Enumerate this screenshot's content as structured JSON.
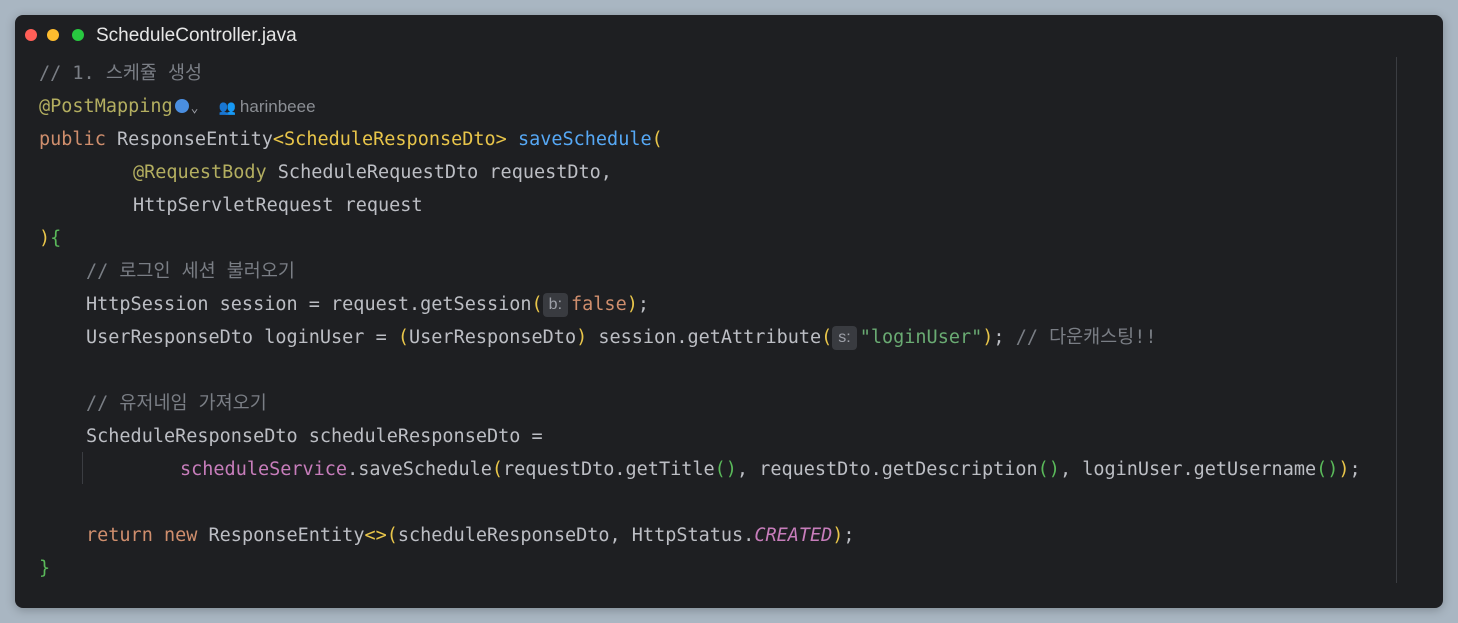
{
  "window": {
    "title": "ScheduleController.java"
  },
  "code": {
    "l1_comment": "// 1. 스케쥴 생성",
    "l2_annotation": "@PostMapping",
    "l2_author": "harinbeee",
    "l3_public": "public",
    "l3_type": " ResponseEntity",
    "l3_generic": "<ScheduleResponseDto>",
    "l3_method": "saveSchedule",
    "l3_paren": "(",
    "l4_annotation": "@RequestBody",
    "l4_rest": " ScheduleRequestDto requestDto,",
    "l5": "HttpServletRequest request",
    "l6_close": ")",
    "l6_brace": "{",
    "l7_comment": "// 로그인 세션 불러오기",
    "l8_pre": "HttpSession session = request.getSession",
    "l8_open": "(",
    "l8_hint": "b:",
    "l8_value": "false",
    "l8_close": ")",
    "l8_end": ";",
    "l9_pre": "UserResponseDto loginUser = ",
    "l9_cast_open": "(",
    "l9_cast": "UserResponseDto",
    "l9_cast_close": ")",
    "l9_mid": " session.getAttribute",
    "l9_open": "(",
    "l9_hint": "s:",
    "l9_str": "\"loginUser\"",
    "l9_close": ")",
    "l9_end": "; ",
    "l9_comment": "// 다운캐스팅!!",
    "l11_comment": "// 유저네임 가져오기",
    "l12": "ScheduleResponseDto scheduleResponseDto =",
    "l13_field": "scheduleService",
    "l13_method": ".saveSchedule",
    "l13_open": "(",
    "l13_a1": "requestDto.getTitle",
    "l13_p1": "()",
    "l13_s1": ", requestDto.getDescription",
    "l13_p2": "()",
    "l13_s2": ", loginUser.getUsername",
    "l13_p3": "()",
    "l13_close": ")",
    "l13_end": ";",
    "l15_return": "return",
    "l15_new": " new",
    "l15_type": " ResponseEntity",
    "l15_diamond": "<>",
    "l15_open": "(",
    "l15_args": "scheduleResponseDto, HttpStatus.",
    "l15_const": "CREATED",
    "l15_close": ")",
    "l15_end": ";",
    "l16_brace": "}"
  },
  "colors": {
    "background": "#1e1f22",
    "keyword": "#cf8e6d",
    "annotation": "#b3ae60",
    "function": "#56a8f5",
    "field": "#c77dbb",
    "string": "#6aab73",
    "comment": "#7a7e85"
  },
  "icons": [
    "close-dot",
    "minimize-dot",
    "maximize-dot",
    "globe-icon",
    "chevron-down-icon",
    "person-icon"
  ]
}
